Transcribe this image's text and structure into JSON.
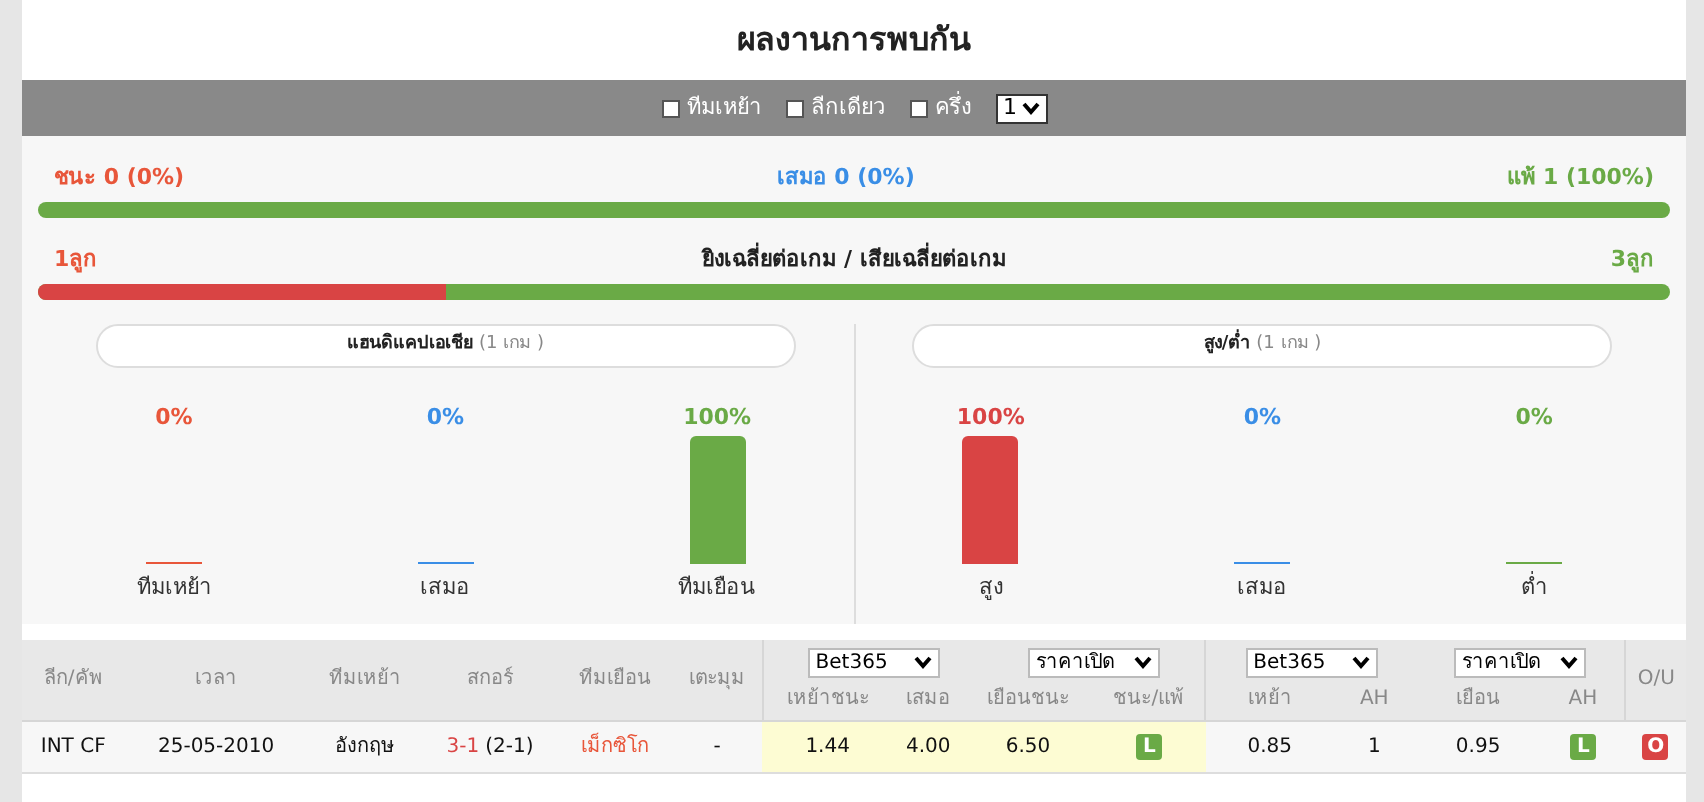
{
  "title": "ผลงานการพบกัน",
  "filters": [
    {
      "label": "ทีมเหย้า",
      "checked": false
    },
    {
      "label": "ลีกเดียว",
      "checked": false
    },
    {
      "label": "ครึ่ง",
      "checked": false
    }
  ],
  "count_select": "1",
  "results": {
    "win": "ชนะ 0 (0%)",
    "draw": "เสมอ 0 (0%)",
    "loss": "แพ้ 1 (100%)"
  },
  "goals": {
    "for": "1ลูก",
    "title": "ยิงเฉลี่ยต่อเกม / เสียเฉลี่ยต่อเกม",
    "against": "3ลูก",
    "level": 0.25
  },
  "panels": [
    {
      "title": "แฮนดิแคปเอเชีย",
      "count": "(1 เกม )",
      "bars": [
        {
          "label": "ทีมเหย้า",
          "value": "0%",
          "level": 0,
          "color": "#e8563a"
        },
        {
          "label": "เสมอ",
          "value": "0%",
          "level": 0,
          "color": "#3a8ee6"
        },
        {
          "label": "ทีมเยือน",
          "value": "100%",
          "level": 1,
          "color": "#6aaa46"
        }
      ]
    },
    {
      "title": "สูง/ต่ำ",
      "count": "(1 เกม )",
      "bars": [
        {
          "label": "สูง",
          "value": "100%",
          "level": 1,
          "color": "#d94444"
        },
        {
          "label": "เสมอ",
          "value": "0%",
          "level": 0,
          "color": "#3a8ee6"
        },
        {
          "label": "ต่ำ",
          "value": "0%",
          "level": 0,
          "color": "#6aaa46"
        }
      ]
    }
  ],
  "table": {
    "columns": [
      "ลีก/คัพ",
      "เวลา",
      "ทีมเหย้า",
      "สกอร์",
      "ทีมเยือน",
      "เตะมุม"
    ],
    "odds_selects": [
      {
        "company": "Bet365",
        "type": "ราคาเปิด"
      },
      {
        "company": "Bet365",
        "type": "ราคาเปิด"
      }
    ],
    "odds_columns": [
      "เหย้าชนะ",
      "เสมอ",
      "เยือนชนะ",
      "ชนะ/แพ้"
    ],
    "ah_columns": [
      "เหย้า",
      "AH",
      "เยือน",
      "AH"
    ],
    "ou_column": "O/U",
    "rows": [
      {
        "league": "INT CF",
        "date": "25-05-2010",
        "home": "อังกฤษ",
        "score": "3-1",
        "half": "(2-1)",
        "away": "เม็กซิโก",
        "corner": "-",
        "odds": [
          "1.44",
          "4.00",
          "6.50"
        ],
        "result": {
          "text": "L",
          "color": "#6aaa46"
        },
        "ah": [
          "0.85",
          "1",
          "0.95"
        ],
        "ah_result": {
          "text": "L",
          "color": "#6aaa46"
        },
        "ou_result": {
          "text": "O",
          "color": "#d94444"
        }
      }
    ]
  }
}
